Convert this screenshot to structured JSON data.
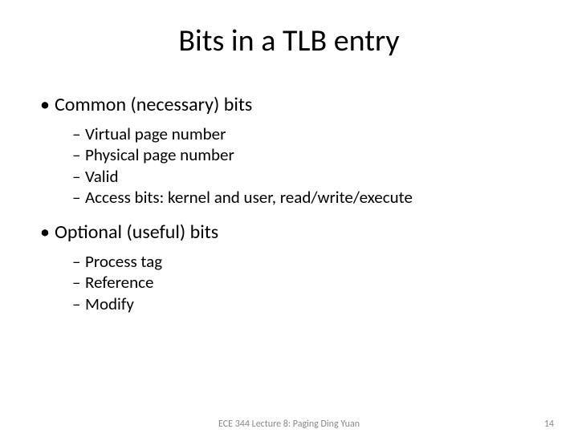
{
  "title": "Bits in a TLB entry",
  "sections": [
    {
      "heading": "Common (necessary) bits",
      "items": [
        "Virtual page number",
        "Physical page number",
        "Valid",
        "Access bits: kernel and user, read/write/execute"
      ]
    },
    {
      "heading": "Optional (useful) bits",
      "items": [
        "Process tag",
        "Reference",
        "Modify"
      ]
    }
  ],
  "footer": {
    "center": "ECE 344 Lecture 8: Paging Ding Yuan",
    "page": "14"
  }
}
